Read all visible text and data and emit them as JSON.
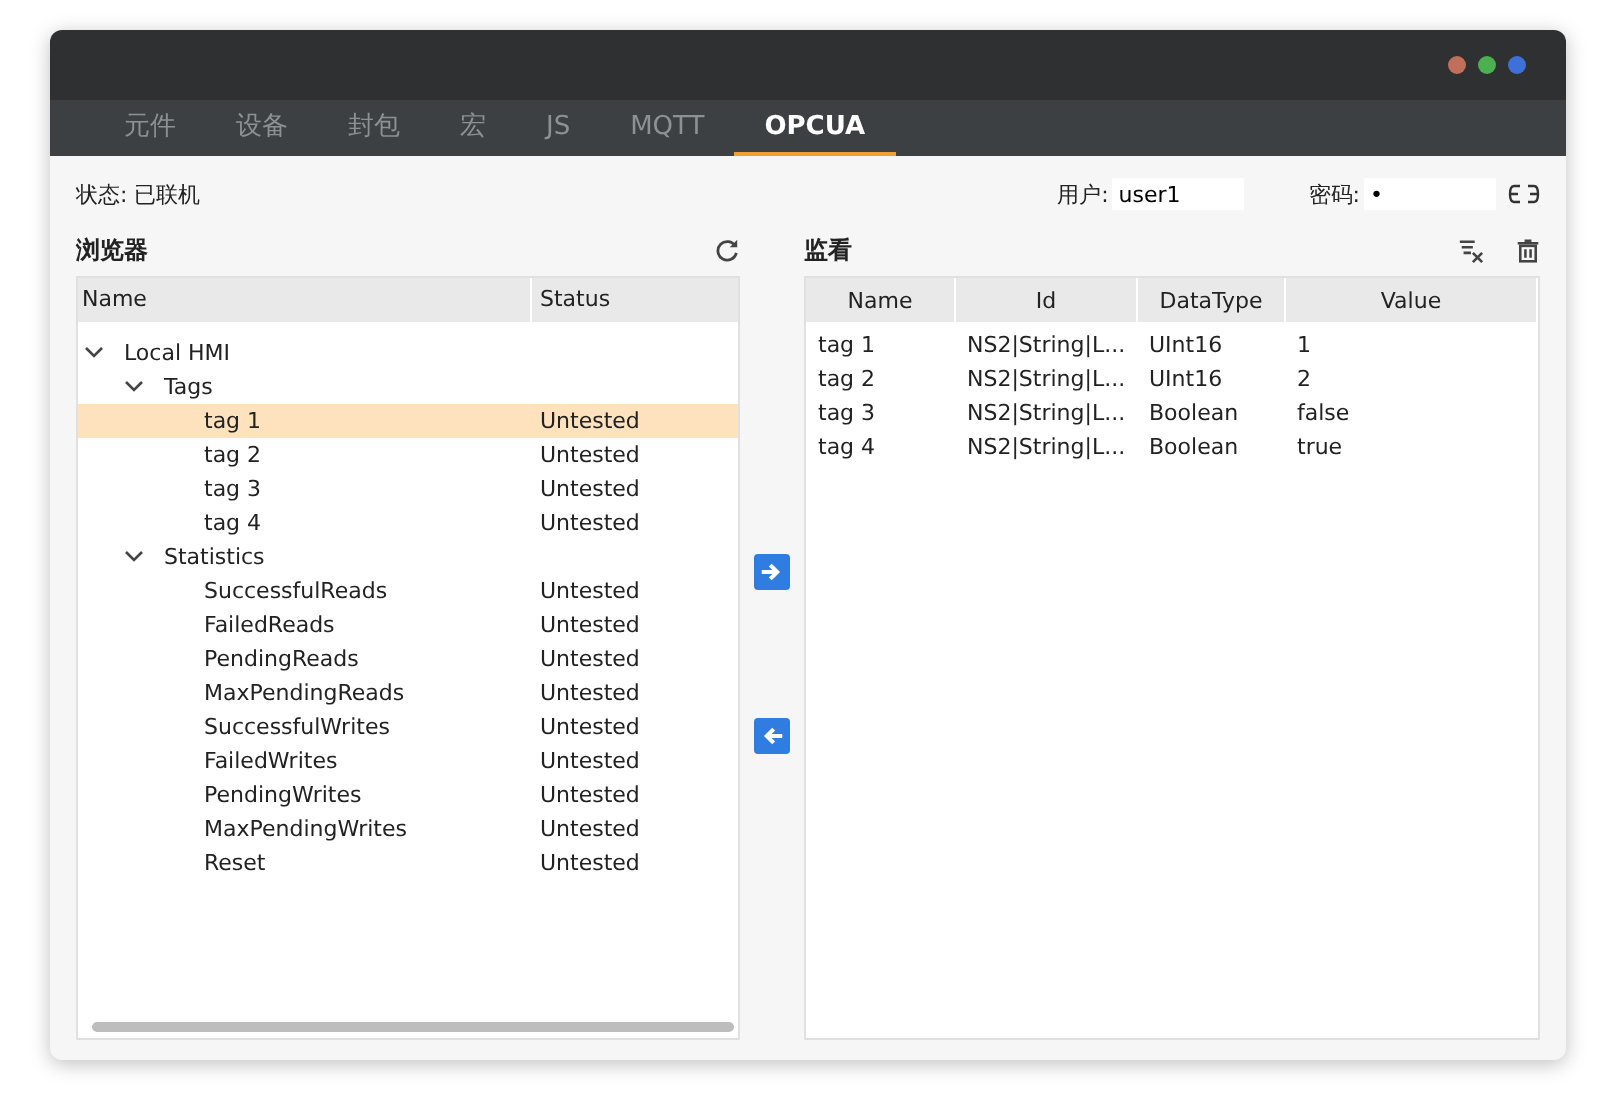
{
  "window": {
    "traffic_lights": [
      {
        "color": "#c0705a"
      },
      {
        "color": "#4caf50"
      },
      {
        "color": "#3f6fd8"
      }
    ]
  },
  "tabs": [
    {
      "label": "元件",
      "selected": false
    },
    {
      "label": "设备",
      "selected": false
    },
    {
      "label": "封包",
      "selected": false
    },
    {
      "label": "宏",
      "selected": false
    },
    {
      "label": "JS",
      "selected": false
    },
    {
      "label": "MQTT",
      "selected": false
    },
    {
      "label": "OPCUA",
      "selected": true
    }
  ],
  "status": {
    "label": "状态:",
    "value": "已联机"
  },
  "login": {
    "user_label": "用户:",
    "user": "user1",
    "password_label": "密码:",
    "password": "•"
  },
  "browser": {
    "title": "浏览器",
    "columns": [
      "Name",
      "Status"
    ],
    "tree": [
      {
        "name": "Local HMI",
        "expanded": true,
        "selected": false,
        "children": [
          {
            "name": "Tags",
            "expanded": true,
            "selected": false,
            "children": [
              {
                "name": "tag 1",
                "status": "Untested",
                "selected": true
              },
              {
                "name": "tag 2",
                "status": "Untested",
                "selected": false
              },
              {
                "name": "tag 3",
                "status": "Untested",
                "selected": false
              },
              {
                "name": "tag 4",
                "status": "Untested",
                "selected": false
              }
            ]
          },
          {
            "name": "Statistics",
            "expanded": true,
            "selected": false,
            "children": [
              {
                "name": "SuccessfulReads",
                "status": "Untested",
                "selected": false
              },
              {
                "name": "FailedReads",
                "status": "Untested",
                "selected": false
              },
              {
                "name": "PendingReads",
                "status": "Untested",
                "selected": false
              },
              {
                "name": "MaxPendingReads",
                "status": "Untested",
                "selected": false
              },
              {
                "name": "SuccessfulWrites",
                "status": "Untested",
                "selected": false
              },
              {
                "name": "FailedWrites",
                "status": "Untested",
                "selected": false
              },
              {
                "name": "PendingWrites",
                "status": "Untested",
                "selected": false
              },
              {
                "name": "MaxPendingWrites",
                "status": "Untested",
                "selected": false
              },
              {
                "name": "Reset",
                "status": "Untested",
                "selected": false
              }
            ]
          }
        ]
      }
    ]
  },
  "watch": {
    "title": "监看",
    "columns": [
      "Name",
      "Id",
      "DataType",
      "Value"
    ],
    "rows": [
      [
        "tag 1",
        "NS2|String|L...",
        "UInt16",
        "1"
      ],
      [
        "tag 2",
        "NS2|String|L...",
        "UInt16",
        "2"
      ],
      [
        "tag 3",
        "NS2|String|L...",
        "Boolean",
        "false"
      ],
      [
        "tag 4",
        "NS2|String|L...",
        "Boolean",
        "true"
      ]
    ]
  }
}
